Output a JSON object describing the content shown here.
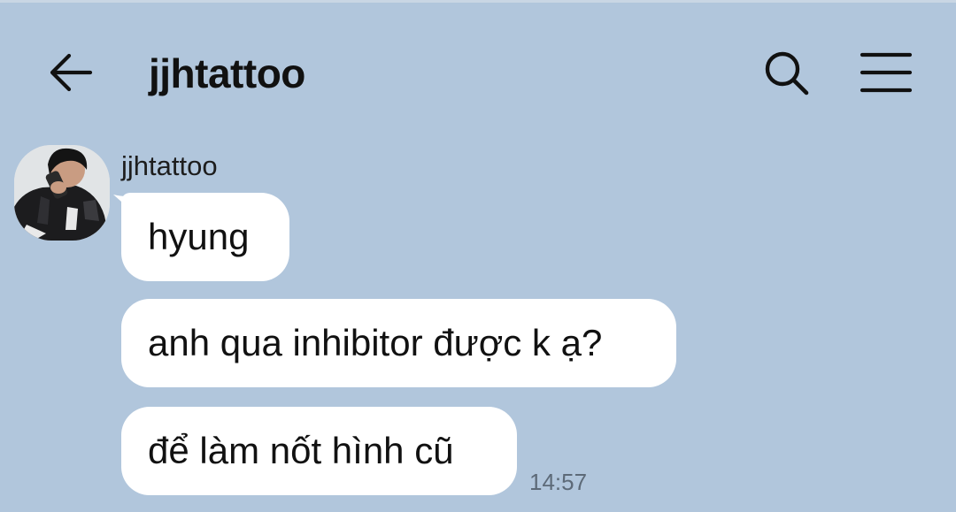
{
  "colors": {
    "background": "#b1c6dc",
    "bubble": "#ffffff",
    "text": "#111111",
    "timestamp": "#5d6a78"
  },
  "header": {
    "back_icon": "arrow-left-icon",
    "title": "jjhtattoo",
    "search_icon": "search-icon",
    "menu_icon": "hamburger-menu-icon"
  },
  "chat": {
    "sender": {
      "name": "jjhtattoo",
      "avatar": "profile-photo"
    },
    "messages": [
      {
        "text": "hyung"
      },
      {
        "text": "anh qua inhibitor được k ạ?"
      },
      {
        "text": "để làm nốt hình cũ",
        "time": "14:57"
      }
    ]
  }
}
